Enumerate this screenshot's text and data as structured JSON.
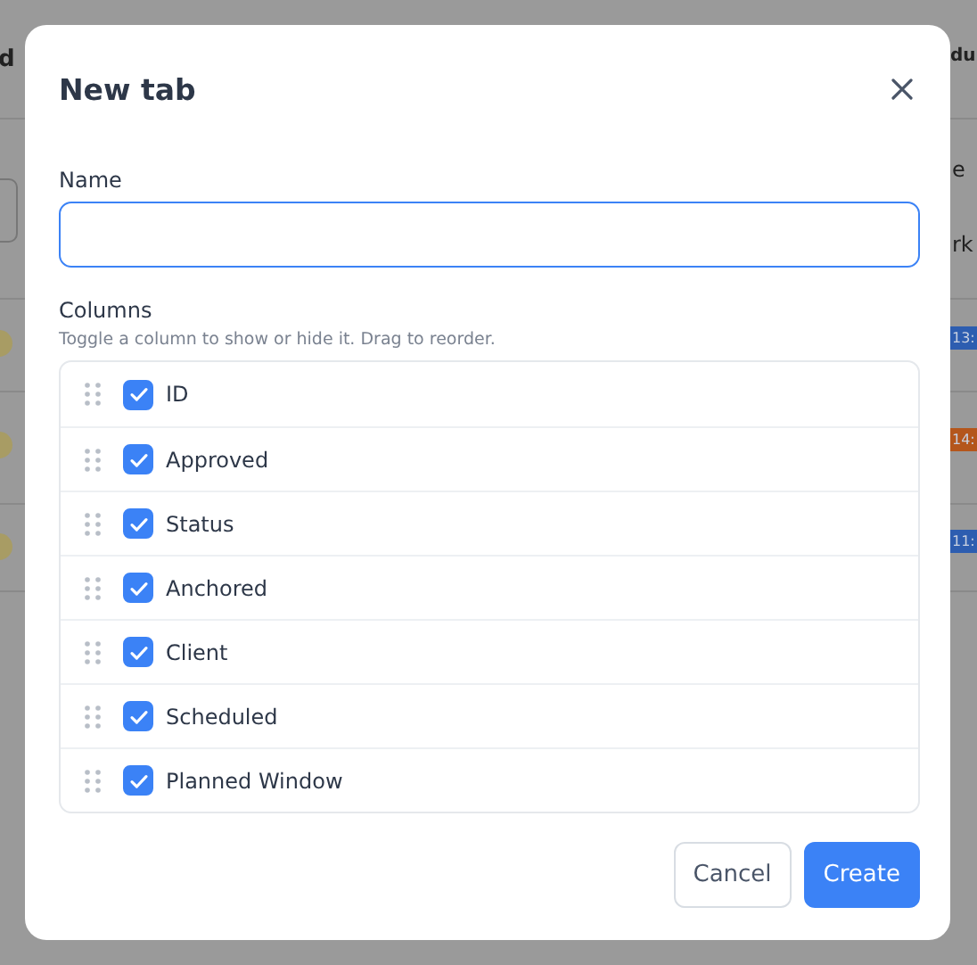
{
  "backdrop": {
    "left_texts": [
      "d"
    ],
    "right_texts": [
      "du",
      "e",
      "rk"
    ],
    "right_chips": [
      {
        "text": "13:",
        "color": "#2d5db0"
      },
      {
        "text": "14:",
        "color": "#b4561c"
      },
      {
        "text": "11:",
        "color": "#2d5db0"
      }
    ]
  },
  "dialog": {
    "title": "New tab",
    "name_field": {
      "label": "Name"
    },
    "columns_label": "Columns",
    "columns_hint": "Toggle a column to show or hide it. Drag to reorder.",
    "columns": [
      {
        "label": "ID",
        "checked": true
      },
      {
        "label": "Approved",
        "checked": true
      },
      {
        "label": "Status",
        "checked": true
      },
      {
        "label": "Anchored",
        "checked": true
      },
      {
        "label": "Client",
        "checked": true
      },
      {
        "label": "Scheduled",
        "checked": true
      },
      {
        "label": "Planned Window",
        "checked": true
      }
    ],
    "buttons": [
      {
        "label": "Cancel",
        "kind": "secondary"
      },
      {
        "label": "Create",
        "kind": "primary"
      }
    ]
  }
}
